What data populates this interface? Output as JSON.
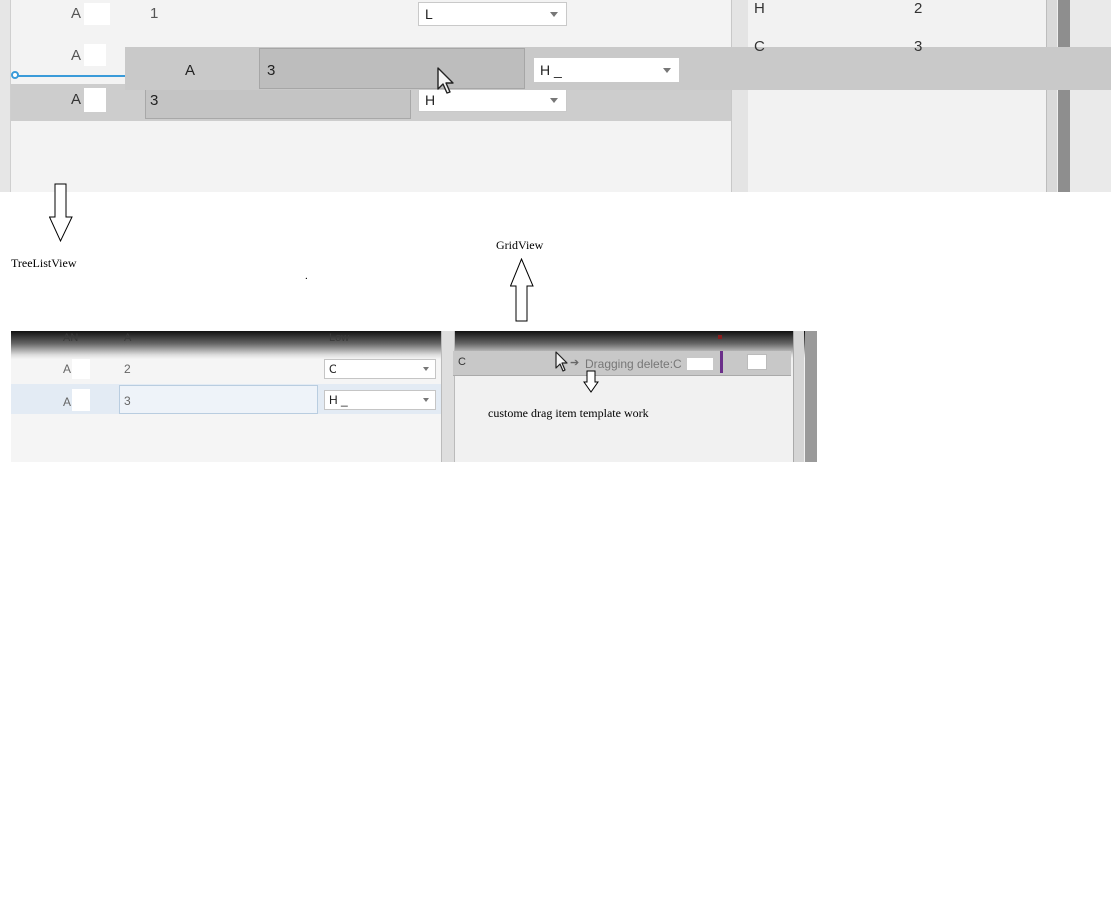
{
  "top_view": {
    "rows": [
      {
        "col1": "A",
        "col2": "1",
        "combo": "L"
      },
      {
        "col1": "A"
      },
      {
        "col1": "A",
        "col2": "3",
        "combo": "H"
      }
    ],
    "drag_row": {
      "col1": "A",
      "col2": "3",
      "combo": "H _"
    },
    "right_grid": [
      {
        "name": "H",
        "value": "2"
      },
      {
        "name": "C",
        "value": "3"
      }
    ]
  },
  "annotations": {
    "treelistview_label": "TreeListView",
    "gridview_label": "GridView",
    "dot": ".",
    "note": "custome drag item template work"
  },
  "bottom_view": {
    "header": {
      "col1": "AN",
      "col2": "A",
      "col3": "Low"
    },
    "rows": [
      {
        "col1": "A",
        "col2": "2",
        "combo": "C"
      },
      {
        "col1": "A",
        "col2": "3",
        "combo": "H _"
      }
    ],
    "right_row": {
      "name": "C"
    },
    "drag_hint": "Dragging delete:C"
  },
  "colors": {
    "indicator": "#3a9bd9",
    "drag_marker": "#6b2f8a",
    "drag_row_bg": "#c9c9c9"
  },
  "icons": [
    "cursor-icon",
    "dropdown-arrow-icon",
    "arrow-down-icon",
    "arrow-up-icon",
    "drop-indicator-icon",
    "arrow-right-icon"
  ]
}
